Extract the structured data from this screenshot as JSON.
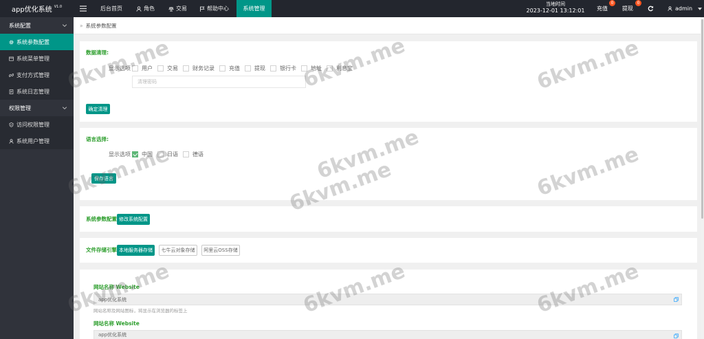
{
  "app": {
    "title": "app优化系统",
    "version": "V1.0"
  },
  "header": {
    "menu_icon": "menu-icon",
    "nav": [
      {
        "label": "后台首页",
        "active": false
      },
      {
        "label": "角色",
        "icon": "user-icon",
        "active": false
      },
      {
        "label": "交易",
        "icon": "scale-icon",
        "active": false
      },
      {
        "label": "帮助中心",
        "icon": "flag-icon",
        "active": false
      },
      {
        "label": "系统管理",
        "active": true
      }
    ],
    "clock": {
      "label": "当地时间",
      "value": "2023-12-01 13:12:01"
    },
    "recharge": {
      "label": "充值",
      "badge": "0"
    },
    "withdraw": {
      "label": "提现",
      "badge": "0"
    },
    "refresh_icon": "refresh-icon",
    "user": {
      "name": "admin",
      "icon": "user-icon"
    }
  },
  "sidebar": {
    "groups": [
      {
        "title": "系统配置",
        "items": [
          {
            "label": "系统参数配置",
            "icon": "gear-icon",
            "active": true
          },
          {
            "label": "系统菜单管理",
            "icon": "window-icon",
            "active": false
          },
          {
            "label": "支付方式管理",
            "icon": "link-icon",
            "active": false
          },
          {
            "label": "系统日志管理",
            "icon": "document-icon",
            "active": false
          }
        ]
      },
      {
        "title": "权限管理",
        "items": [
          {
            "label": "访问权限管理",
            "icon": "shield-icon",
            "active": false
          },
          {
            "label": "系统用户管理",
            "icon": "user-icon",
            "active": false
          }
        ]
      }
    ]
  },
  "breadcrumb": {
    "separator": "»",
    "current": "系统参数配置"
  },
  "cleanup": {
    "title": "数据清理:",
    "options_label": "显示选项",
    "options": [
      {
        "label": "用户",
        "checked": false
      },
      {
        "label": "交易",
        "checked": false
      },
      {
        "label": "财务记录",
        "checked": false
      },
      {
        "label": "充值",
        "checked": false
      },
      {
        "label": "提现",
        "checked": false
      },
      {
        "label": "银行卡",
        "checked": false
      },
      {
        "label": "地址",
        "checked": false
      },
      {
        "label": "利息宝",
        "checked": false
      }
    ],
    "password_placeholder": "清理密码",
    "button": "确定清理"
  },
  "language": {
    "title": "语言选择:",
    "options_label": "显示选项",
    "options": [
      {
        "label": "中国",
        "checked": true
      },
      {
        "label": "日语",
        "checked": false
      },
      {
        "label": "德语",
        "checked": false
      }
    ],
    "button": "保存语言"
  },
  "system_config": {
    "title": "系统参数配置:",
    "button": "修改系统配置"
  },
  "storage": {
    "title": "文件存储引擎:",
    "engines": [
      {
        "label": "本地服务器存储",
        "selected": true
      },
      {
        "label": "七牛云对象存储",
        "selected": false
      },
      {
        "label": "阿里云OSS存储",
        "selected": false
      }
    ]
  },
  "site": {
    "fields": [
      {
        "label": "网站名称 Website",
        "value": "app优化系统",
        "help": "网站名称及网站图标，将显示在浏览器的标签上"
      },
      {
        "label": "网站名称 Website",
        "value": "app优化系统"
      }
    ]
  },
  "watermark": "6kvm.me",
  "colors": {
    "accent": "#009688",
    "label": "#2d9e2d",
    "checkbox": "#5fb878",
    "badge": "#ff5722",
    "header_bg": "#23262e",
    "sidebar_bg": "#30333b",
    "sidebar_item_bg": "#282b32",
    "link": "#1e9fff",
    "page_bg": "#f0f0f0"
  }
}
